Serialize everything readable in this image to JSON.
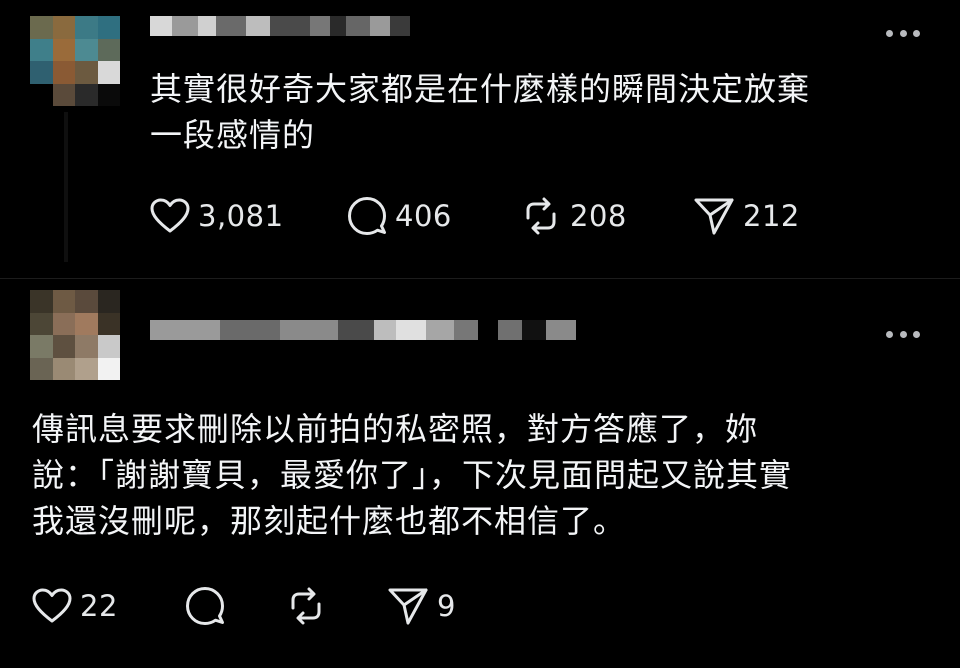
{
  "posts": [
    {
      "text_lines": [
        "其實很好奇大家都是在什麼樣的瞬間決定放棄",
        "一段感情的"
      ],
      "stats": {
        "likes": "3,081",
        "replies": "406",
        "reposts": "208",
        "shares": "212"
      }
    },
    {
      "text_lines": [
        "傳訊息要求刪除以前拍的私密照，對方答應了，妳",
        "說：「謝謝寶貝，最愛你了」，下次見面問起又說其實",
        "我還沒刪呢，那刻起什麼也都不相信了。"
      ],
      "stats": {
        "likes": "22",
        "replies": "",
        "reposts": "",
        "shares": "9"
      }
    }
  ],
  "icons": {
    "like": "heart-icon",
    "reply": "comment-icon",
    "repost": "repost-icon",
    "share": "send-icon",
    "more": "more-dots-icon"
  },
  "colors": {
    "background": "#000000",
    "text": "#f3f5f7",
    "icon": "#e6e8ea",
    "muted": "#b8babe"
  }
}
